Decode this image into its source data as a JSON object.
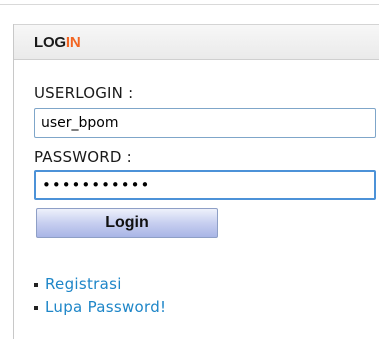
{
  "panel": {
    "title_main": "LOG",
    "title_accent": "IN",
    "accent_color": "#f26522"
  },
  "form": {
    "userlogin_label": "USERLOGIN :",
    "userlogin_value": "user_bpom",
    "password_label": "PASSWORD :",
    "password_value": "•••••••••••",
    "login_button": "Login"
  },
  "links": [
    {
      "label": "Registrasi"
    },
    {
      "label": "Lupa Password!"
    }
  ],
  "colors": {
    "link": "#1e86c8",
    "button_gradient": [
      "#eef1fb",
      "#a9b5e6"
    ]
  }
}
